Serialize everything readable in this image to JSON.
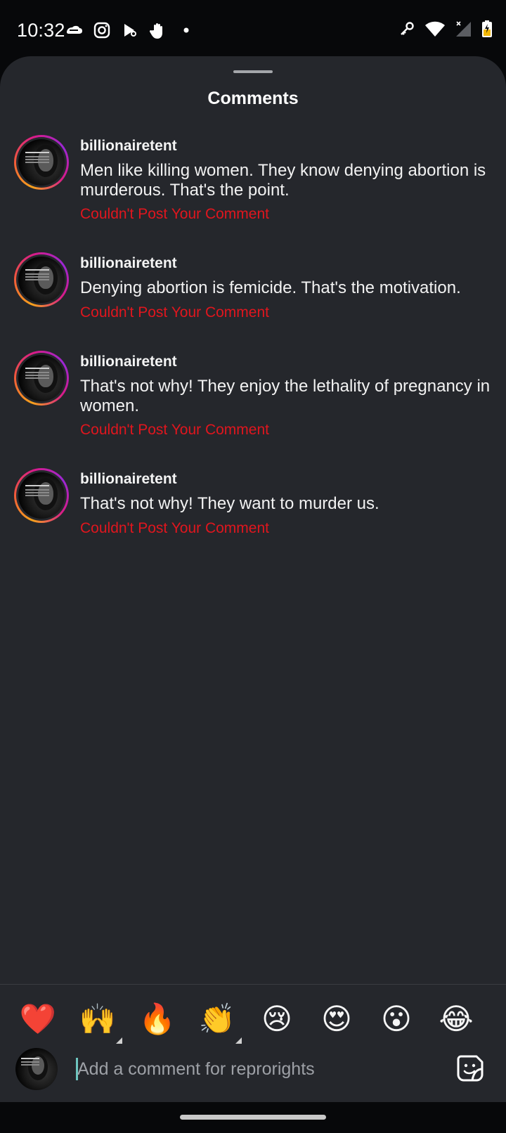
{
  "status_bar": {
    "time": "10:32",
    "left_icons": [
      "cloud-chat-icon",
      "instagram-icon",
      "play-games-icon",
      "hand-icon",
      "dot-icon"
    ],
    "right_icons": [
      "vpn-key-icon",
      "wifi-icon",
      "cellular-no-signal-icon",
      "battery-charging-icon"
    ]
  },
  "sheet": {
    "title": "Comments"
  },
  "comments": [
    {
      "username": "billionairetent",
      "text": "Men like killing women. They know denying abortion is murderous. That's the point.",
      "error": "Couldn't Post Your Comment"
    },
    {
      "username": "billionairetent",
      "text": "Denying abortion is femicide. That's the motivation.",
      "error": "Couldn't Post Your Comment"
    },
    {
      "username": "billionairetent",
      "text": "That's not why!  They enjoy the lethality of pregnancy in women.",
      "error": "Couldn't Post Your Comment"
    },
    {
      "username": "billionairetent",
      "text": "That's not why! They want to murder us.",
      "error": "Couldn't Post Your Comment"
    }
  ],
  "emoji_bar": [
    "❤️",
    "🙌",
    "🔥",
    "👏",
    "😢",
    "😍",
    "😮",
    "😂"
  ],
  "composer": {
    "placeholder": "Add a comment for reprorights",
    "value": ""
  },
  "colors": {
    "sheet_bg": "#25272c",
    "error_red": "#e0161e",
    "text_white": "#f2f2f2",
    "placeholder_gray": "#9da0a6"
  }
}
